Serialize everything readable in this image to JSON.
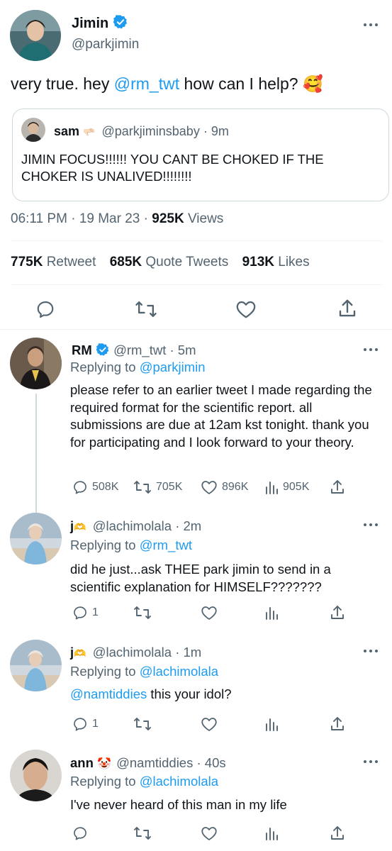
{
  "main_tweet": {
    "name": "Jimin",
    "handle": "@parkjimin",
    "text_pre": "very true. hey ",
    "mention": "@rm_twt",
    "text_post": " how can I help? 🥰",
    "quote": {
      "name": "sam",
      "emoji": "🫳🏻",
      "handle": "@parkjiminsbaby",
      "time": "9m",
      "text": "JIMIN FOCUS!!!!!! YOU CANT BE CHOKED IF THE CHOKER IS UNALIVED!!!!!!!!"
    },
    "time": "06:11 PM",
    "date": "19 Mar 23",
    "views_count": "925K",
    "views_label": "Views",
    "retweets_count": "775K",
    "retweets_label": "Retweet",
    "quotes_count": "685K",
    "quotes_label": "Quote Tweets",
    "likes_count": "913K",
    "likes_label": "Likes"
  },
  "replies": [
    {
      "name": "RM",
      "handle": "@rm_twt",
      "time": "5m",
      "replying_label": "Replying to ",
      "replying_to": "@parkjimin",
      "text": "please refer to an earlier tweet I made regarding the required format for the scientific report. all submissions are due at 12am kst tonight. thank you for participating and I look forward to your theory.",
      "replies": "508K",
      "retweets": "705K",
      "likes": "896K",
      "views": "905K"
    },
    {
      "name": "j",
      "emoji": "🫶",
      "handle": "@lachimolala",
      "time": "2m",
      "replying_label": "Replying to ",
      "replying_to": "@rm_twt",
      "text": "did he just...ask THEE park jimin to send in a scientific explanation for HIMSELF???????",
      "replies": "1"
    },
    {
      "name": "j",
      "emoji": "🫶",
      "handle": "@lachimolala",
      "time": "1m",
      "replying_label": "Replying to ",
      "replying_to": "@lachimolala",
      "text_mention": "@namtiddies",
      "text": " this your idol?",
      "replies": "1"
    },
    {
      "name": "ann",
      "emoji": "🤡",
      "handle": "@namtiddies",
      "time": "40s",
      "replying_label": "Replying to ",
      "replying_to": "@lachimolala",
      "text": "I've never heard of this man in my life"
    }
  ],
  "separator": "·",
  "colors": {
    "link": "#1d9bf0",
    "muted": "#536471",
    "text": "#0f1419",
    "divider": "#eff3f4"
  }
}
